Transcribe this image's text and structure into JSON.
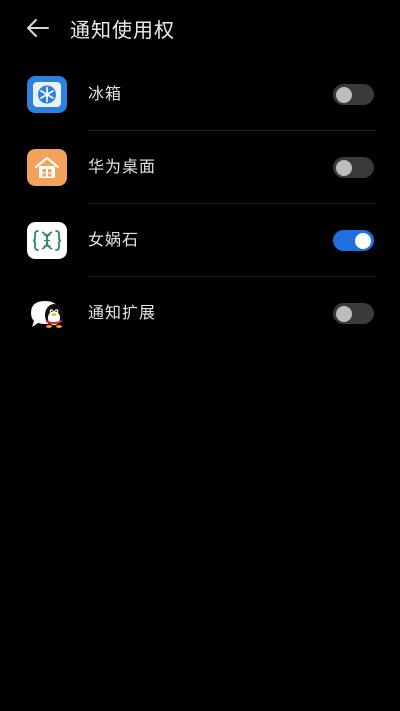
{
  "header": {
    "title": "通知使用权"
  },
  "apps": [
    {
      "name": "冰箱",
      "icon": "snowflake-icon",
      "enabled": false
    },
    {
      "name": "华为桌面",
      "icon": "home-icon",
      "enabled": false
    },
    {
      "name": "女娲石",
      "icon": "dna-icon",
      "enabled": true
    },
    {
      "name": "通知扩展",
      "icon": "qq-penguin-icon",
      "enabled": false
    }
  ],
  "colors": {
    "background": "#000000",
    "toggle_on": "#1f6fe0",
    "toggle_off": "#3a3a3a"
  }
}
